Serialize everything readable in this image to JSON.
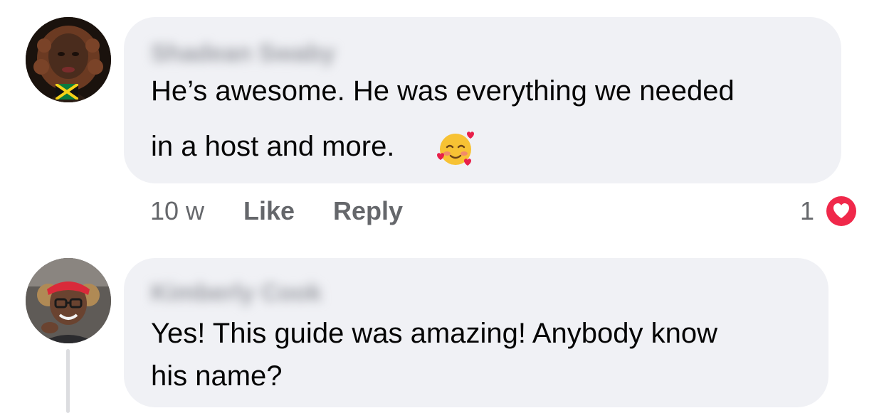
{
  "comments": [
    {
      "author": "Shadean Swaby",
      "text_line_1": "He’s awesome. He was everything we needed",
      "text_line_2": "in a host and more.",
      "emoji": "smiling-face-with-hearts",
      "timestamp": "10 w",
      "like_label": "Like",
      "reply_label": "Reply",
      "reaction_count": "1",
      "reaction_type": "love"
    },
    {
      "author": "Kimberly Cook",
      "text_line_1": "Yes! This guide was amazing! Anybody know",
      "text_line_2": "his name?"
    }
  ],
  "colors": {
    "bubble": "#f0f1f5",
    "text": "#050505",
    "secondary": "#65676b",
    "love": "#f0284a"
  }
}
